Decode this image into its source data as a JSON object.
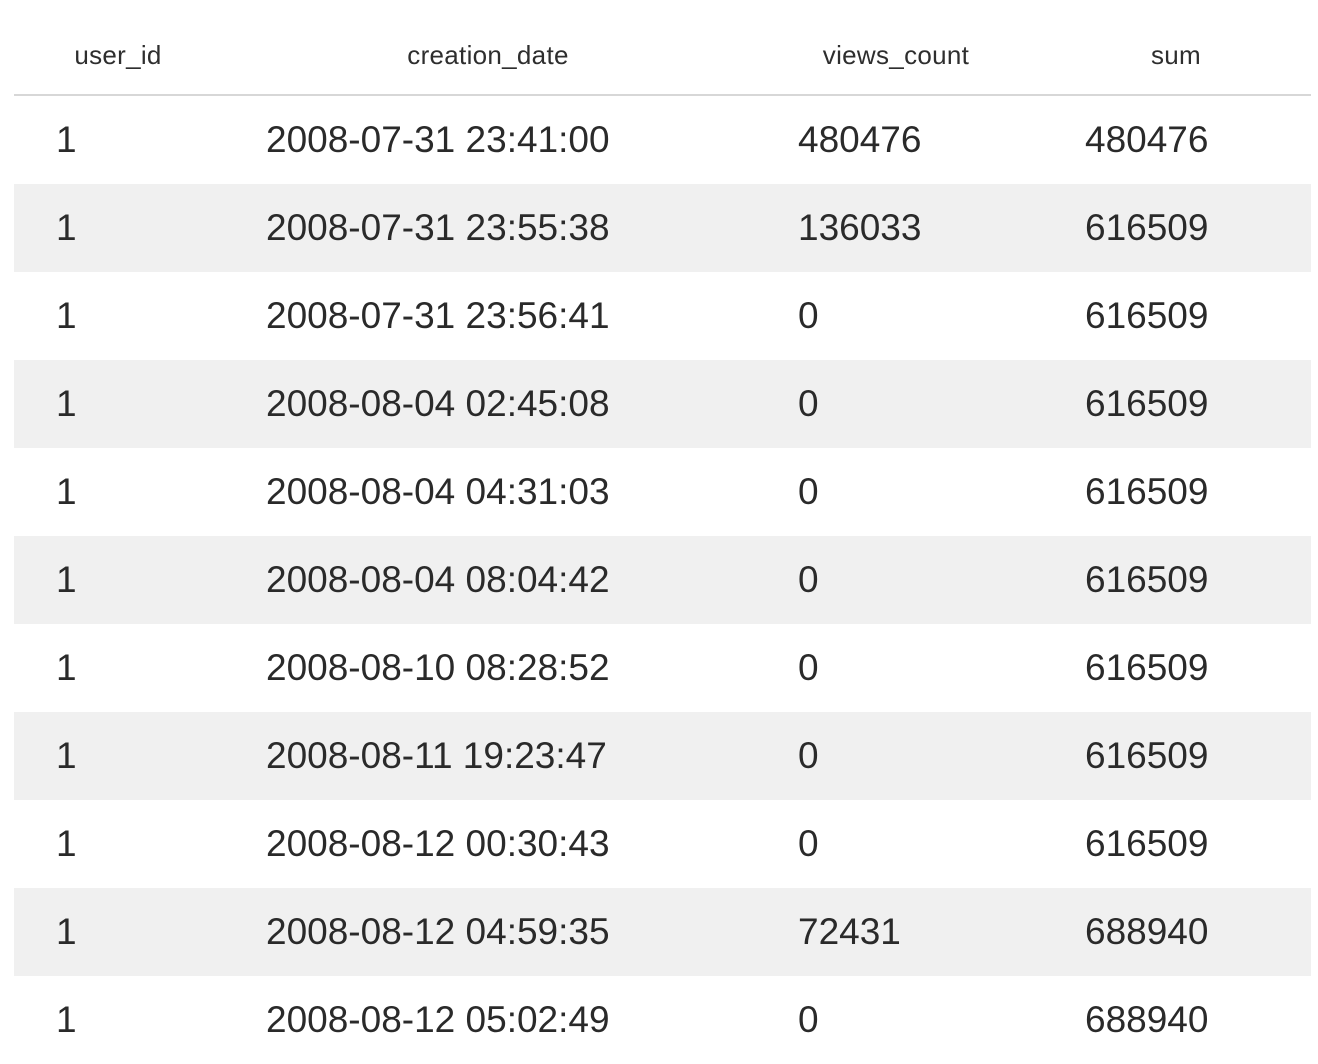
{
  "table": {
    "columns": [
      "user_id",
      "creation_date",
      "views_count",
      "sum"
    ],
    "rows": [
      {
        "user_id": "1",
        "creation_date": "2008-07-31 23:41:00",
        "views_count": "480476",
        "sum": "480476"
      },
      {
        "user_id": "1",
        "creation_date": "2008-07-31 23:55:38",
        "views_count": "136033",
        "sum": "616509"
      },
      {
        "user_id": "1",
        "creation_date": "2008-07-31 23:56:41",
        "views_count": "0",
        "sum": "616509"
      },
      {
        "user_id": "1",
        "creation_date": "2008-08-04 02:45:08",
        "views_count": "0",
        "sum": "616509"
      },
      {
        "user_id": "1",
        "creation_date": "2008-08-04 04:31:03",
        "views_count": "0",
        "sum": "616509"
      },
      {
        "user_id": "1",
        "creation_date": "2008-08-04 08:04:42",
        "views_count": "0",
        "sum": "616509"
      },
      {
        "user_id": "1",
        "creation_date": "2008-08-10 08:28:52",
        "views_count": "0",
        "sum": "616509"
      },
      {
        "user_id": "1",
        "creation_date": "2008-08-11 19:23:47",
        "views_count": "0",
        "sum": "616509"
      },
      {
        "user_id": "1",
        "creation_date": "2008-08-12 00:30:43",
        "views_count": "0",
        "sum": "616509"
      },
      {
        "user_id": "1",
        "creation_date": "2008-08-12 04:59:35",
        "views_count": "72431",
        "sum": "688940"
      },
      {
        "user_id": "1",
        "creation_date": "2008-08-12 05:02:49",
        "views_count": "0",
        "sum": "688940"
      }
    ]
  }
}
